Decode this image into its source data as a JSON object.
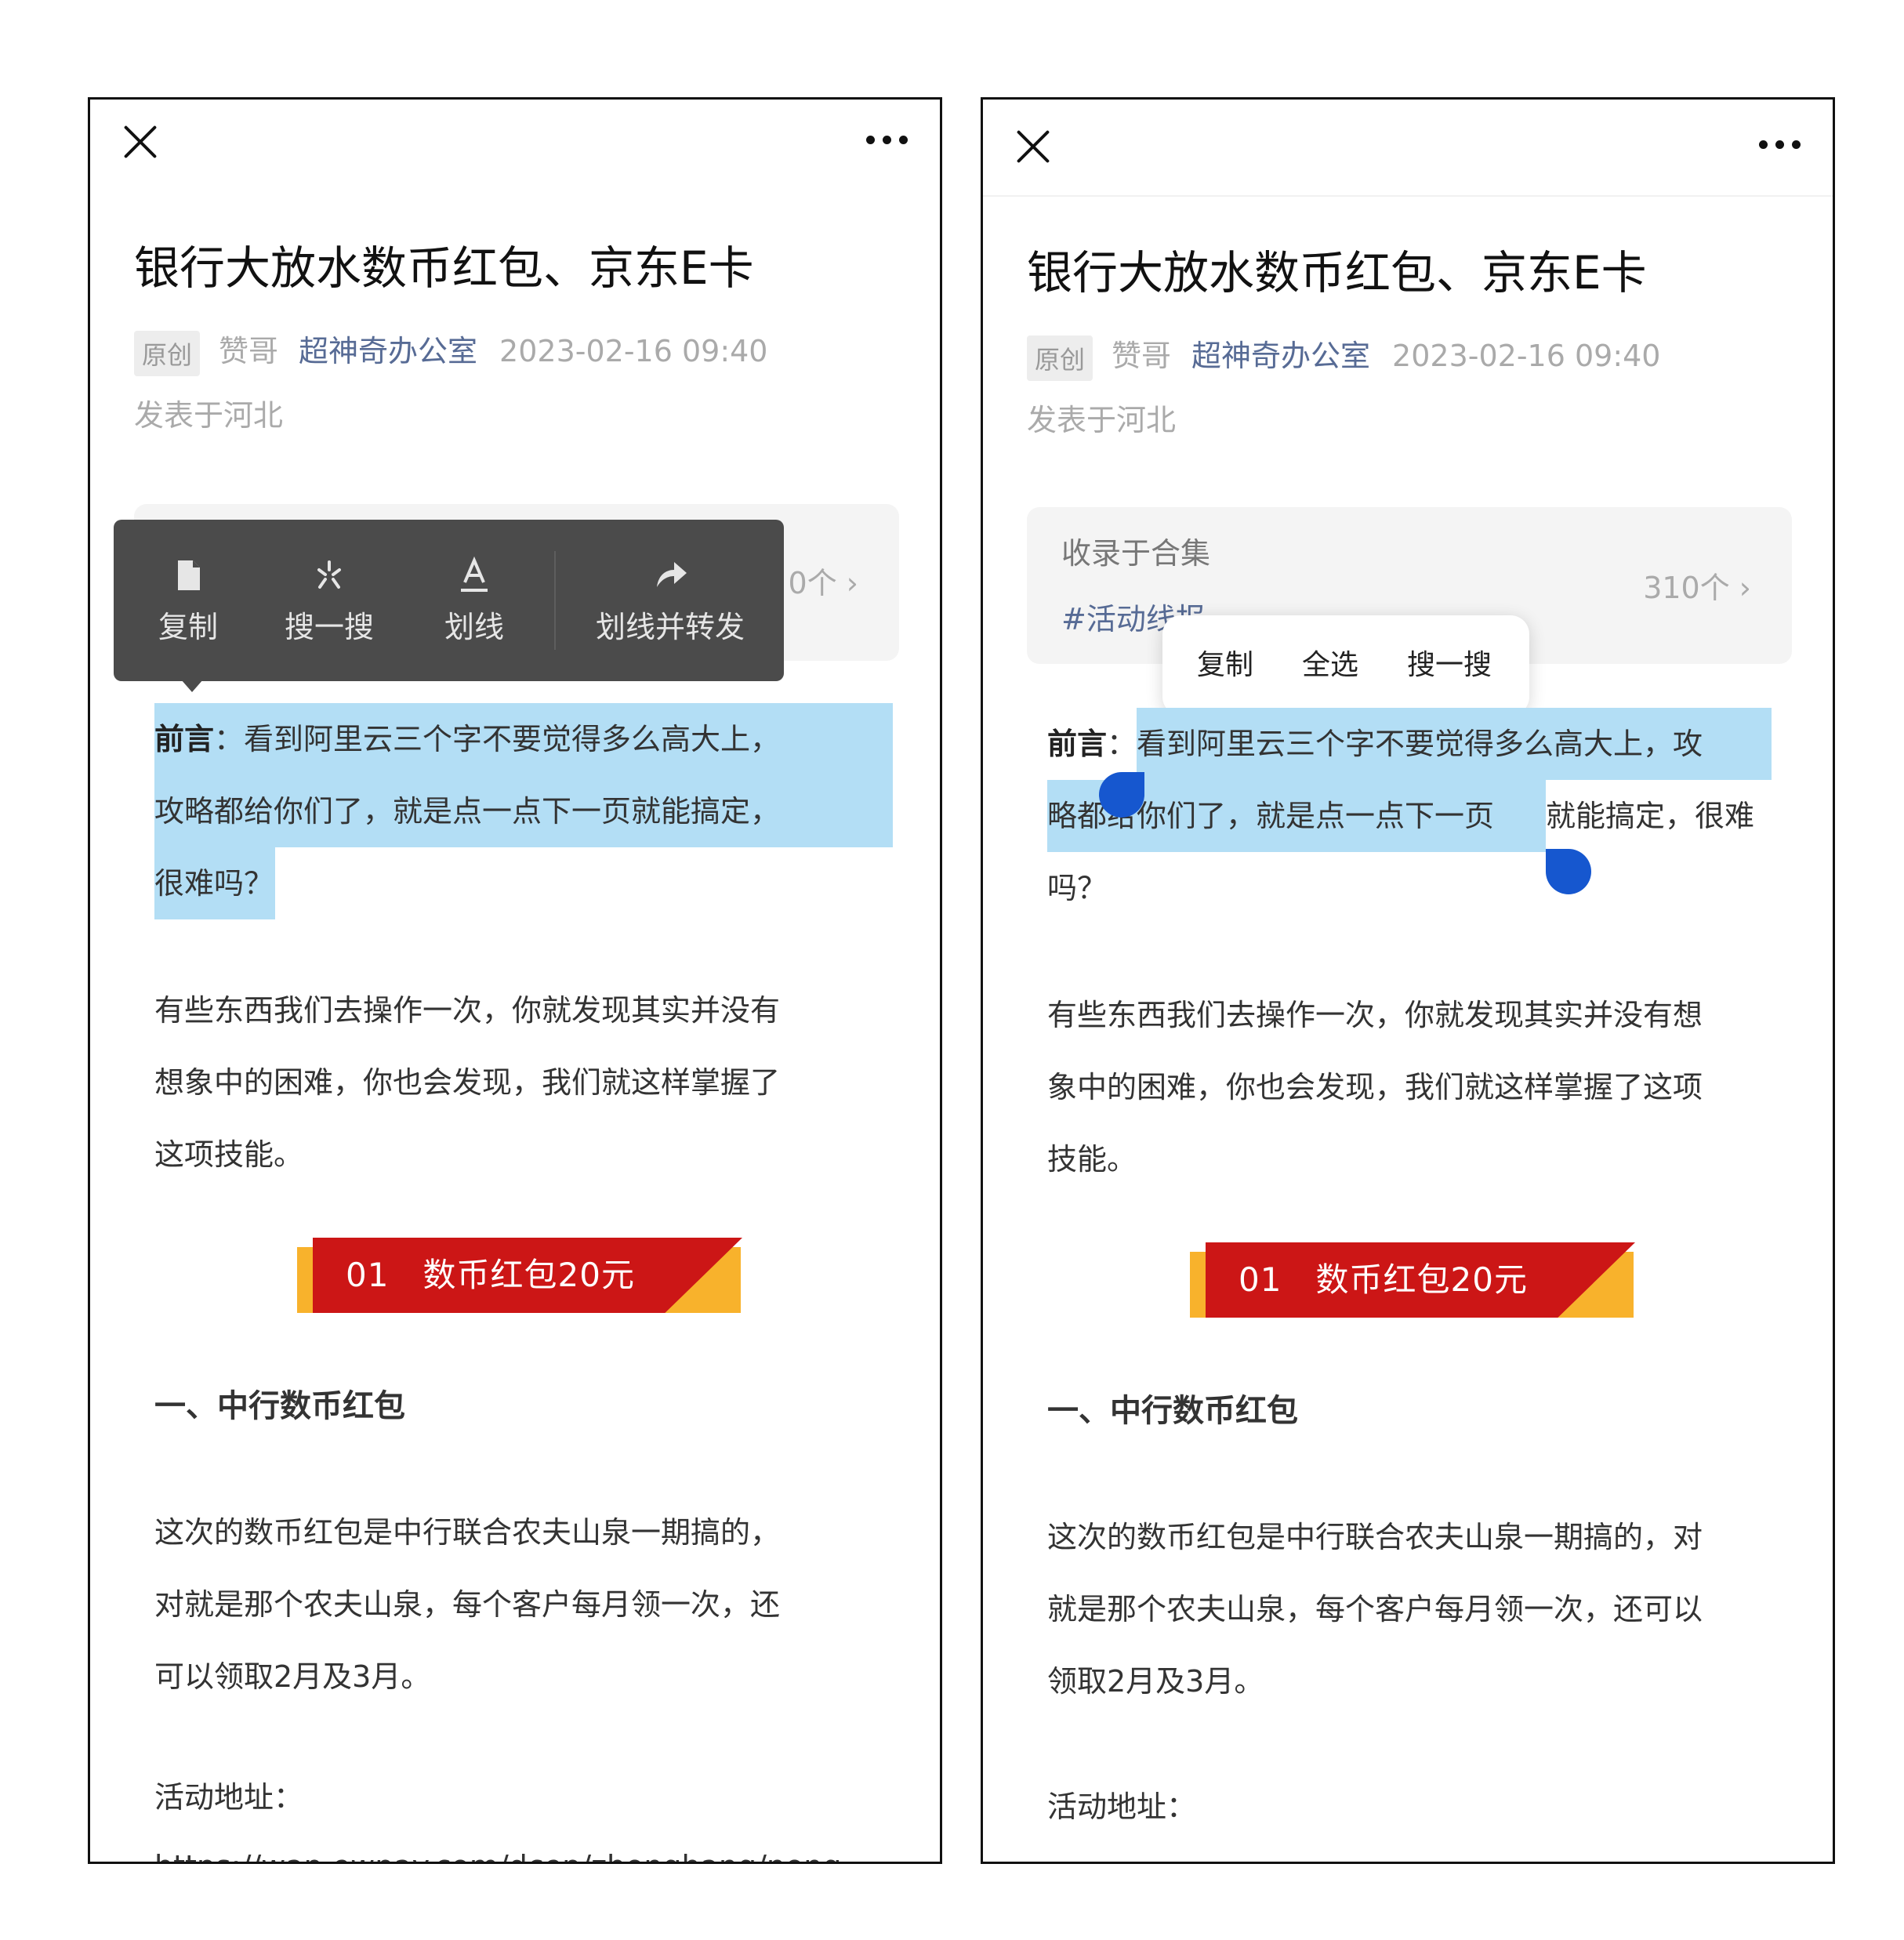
{
  "article": {
    "title": "银行大放水数币红包、京东E卡",
    "original_tag": "原创",
    "author": "赞哥",
    "account": "超神奇办公室",
    "date": "2023-02-16 09:40",
    "location": "发表于河北",
    "collection_label": "收录于合集",
    "collection_name": "#活动线报",
    "collection_count": "310个",
    "collection_count_partial": "0个",
    "preface_label": "前言",
    "preface_colon": "：",
    "preface_left": {
      "line1": "看到阿里云三个字不要觉得多么高大上，",
      "line2": "攻略都给你们了，就是点一点下一页就能搞定，",
      "line3": "很难吗？"
    },
    "preface_right": {
      "line1_sel": "看到阿里云三个字不要觉得多么高大上，攻",
      "line2_pre": "略都",
      "line2_sel_rest": "给你们了，就是点一点下一页",
      "line2_tail": "就能搞定，很难",
      "line3": "吗？"
    },
    "para1_left": [
      "有些东西我们去操作一次，你就发现其实并没有",
      "想象中的困难，你也会发现，我们就这样掌握了",
      "这项技能。"
    ],
    "para1_right": [
      "有些东西我们去操作一次，你就发现其实并没有想",
      "象中的困难，你也会发现，我们就这样掌握了这项",
      "技能。"
    ],
    "banner_num": "01",
    "banner_text": "数币红包20元",
    "section1": "一、中行数币红包",
    "para2_left": [
      "这次的数币红包是中行联合农夫山泉一期搞的，",
      "对就是那个农夫山泉，每个客户每月领一次，还",
      "可以领取2月及3月。"
    ],
    "para2_right": [
      "这次的数币红包是中行联合农夫山泉一期搞的，对",
      "就是那个农夫山泉，每个客户每月领一次，还可以",
      "领取2月及3月。"
    ],
    "address_label": "活动地址：",
    "address_url": "https://wap.ewpay.com/dcep/zhonghang/nong"
  },
  "dark_menu": {
    "copy": "复制",
    "search": "搜一搜",
    "underline": "划线",
    "underline_share": "划线并转发"
  },
  "light_menu": {
    "copy": "复制",
    "select_all": "全选",
    "search": "搜一搜"
  },
  "colors": {
    "selection": "#b3def5",
    "handle": "#1657cf",
    "banner_red": "#cc1616",
    "banner_orange": "#f8b22c",
    "account_blue": "#576b95",
    "dark_menu_bg": "#4b4b4b"
  }
}
